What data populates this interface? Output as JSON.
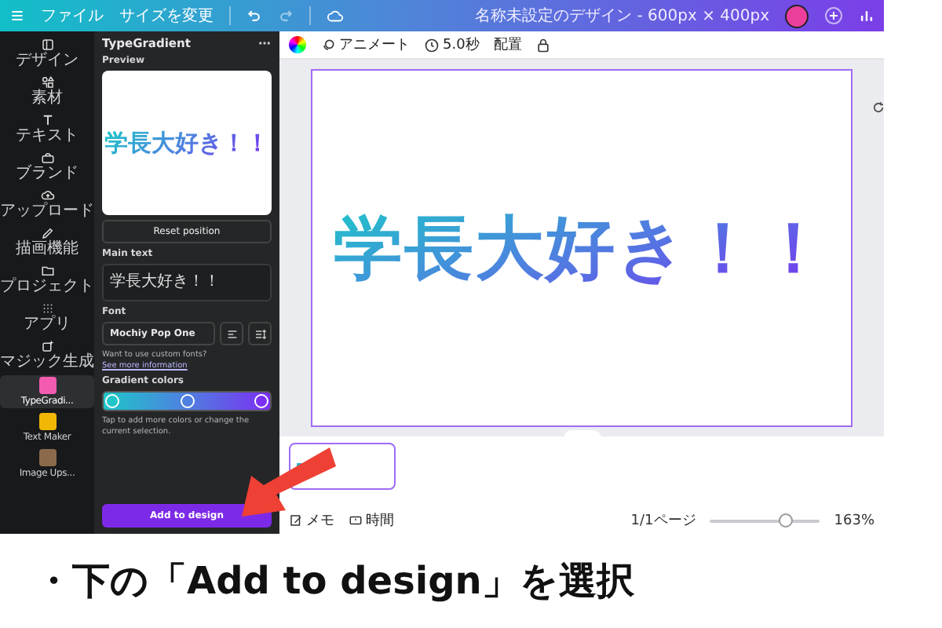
{
  "top_bar": {
    "file_menu": "ファイル",
    "resize_button": "サイズを変更",
    "design_title": "名称未設定のデザイン - 600px × 400px"
  },
  "sidebar": {
    "items": [
      {
        "label": "デザイン",
        "kind": "tool",
        "selected": false
      },
      {
        "label": "素材",
        "kind": "tool",
        "selected": false
      },
      {
        "label": "テキスト",
        "kind": "tool",
        "selected": false
      },
      {
        "label": "ブランド",
        "kind": "tool",
        "selected": false
      },
      {
        "label": "アップロード",
        "kind": "tool",
        "selected": false
      },
      {
        "label": "描画機能",
        "kind": "tool",
        "selected": false
      },
      {
        "label": "プロジェクト",
        "kind": "tool",
        "selected": false
      },
      {
        "label": "アプリ",
        "kind": "tool",
        "selected": false
      },
      {
        "label": "マジック生成",
        "kind": "tool",
        "selected": false
      },
      {
        "label": "TypeGradi...",
        "kind": "app",
        "color": "#f25bb0",
        "selected": true
      },
      {
        "label": "Text Maker",
        "kind": "app",
        "color": "#f2b705",
        "selected": false
      },
      {
        "label": "Image Ups...",
        "kind": "app",
        "color": "#8a6a4a",
        "selected": false
      }
    ]
  },
  "panel": {
    "title": "TypeGradient",
    "preview_label": "Preview",
    "preview_text": "学長大好き！！",
    "reset_button": "Reset position",
    "main_text_label": "Main text",
    "main_text_value": "学長大好き！！",
    "font_label": "Font",
    "font_value": "Mochiy Pop One",
    "custom_font_hint": "Want to use custom fonts?",
    "custom_font_link": "See more information",
    "gradient_label": "Gradient colors",
    "gradient_stops": [
      {
        "color": "#1ec6c9"
      },
      {
        "color": "#4f7fe0"
      },
      {
        "color": "#7b2ff2"
      }
    ],
    "gradient_hint": "Tap to add more colors or change the current selection.",
    "add_button": "Add to design"
  },
  "toolbar": {
    "animate_button": "アニメート",
    "duration_button": "5.0秒",
    "position_button": "配置"
  },
  "canvas": {
    "text": "学長大好き！！"
  },
  "footer": {
    "notes_button": "メモ",
    "timer_button": "時間",
    "page_indicator": "1/1ページ",
    "zoom": {
      "level": 0.69
    },
    "zoom_percent": "163%"
  },
  "caption": "・下の「Add to design」を選択"
}
